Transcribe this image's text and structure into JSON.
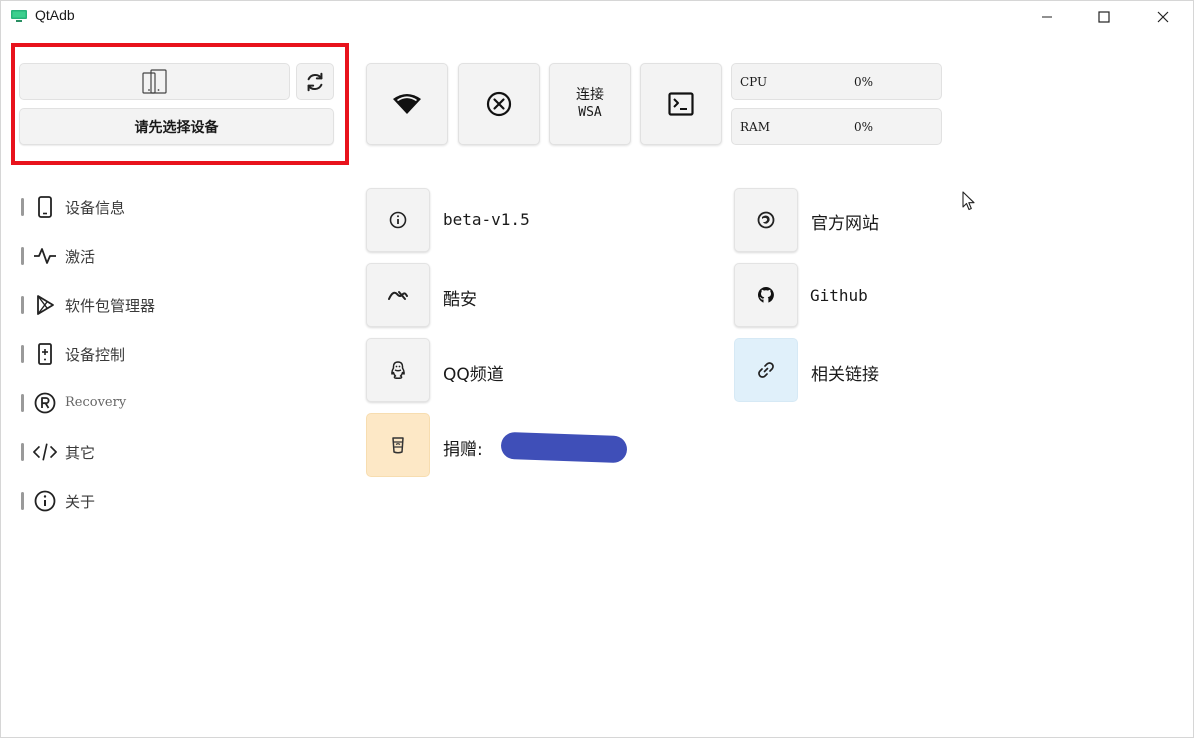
{
  "window": {
    "title": "QtAdb"
  },
  "colors": {
    "highlight": "#e8121c",
    "redact": "#3f4fb8",
    "blue_tile": "#e0f0fa",
    "orange_tile": "#fde8c6"
  },
  "device_panel": {
    "device_icon": "two-phones-icon",
    "refresh_icon": "refresh-icon",
    "select_label": "请先选择设备"
  },
  "sidebar": {
    "items": [
      {
        "label": "设备信息",
        "icon": "phone-icon"
      },
      {
        "label": "激活",
        "icon": "activity-icon"
      },
      {
        "label": "软件包管理器",
        "icon": "play-icon"
      },
      {
        "label": "设备控制",
        "icon": "remote-icon"
      },
      {
        "label": "Recovery",
        "icon": "registered-icon"
      },
      {
        "label": "其它",
        "icon": "code-icon"
      },
      {
        "label": "关于",
        "icon": "info-icon"
      }
    ]
  },
  "toolbar": {
    "wifi_icon": "wifi-icon",
    "disconnect_icon": "close-circle-icon",
    "wsa_line1": "连接",
    "wsa_line2": "WSA",
    "terminal_icon": "terminal-icon"
  },
  "stats": {
    "cpu_label": "CPU",
    "cpu_value": "0%",
    "ram_label": "RAM",
    "ram_value": "0%"
  },
  "about": {
    "version": "beta-v1.5",
    "website": "官方网站",
    "coolapk": "酷安",
    "github": "Github",
    "qq": "QQ频道",
    "links": "相关链接",
    "donate": "捐赠: "
  }
}
